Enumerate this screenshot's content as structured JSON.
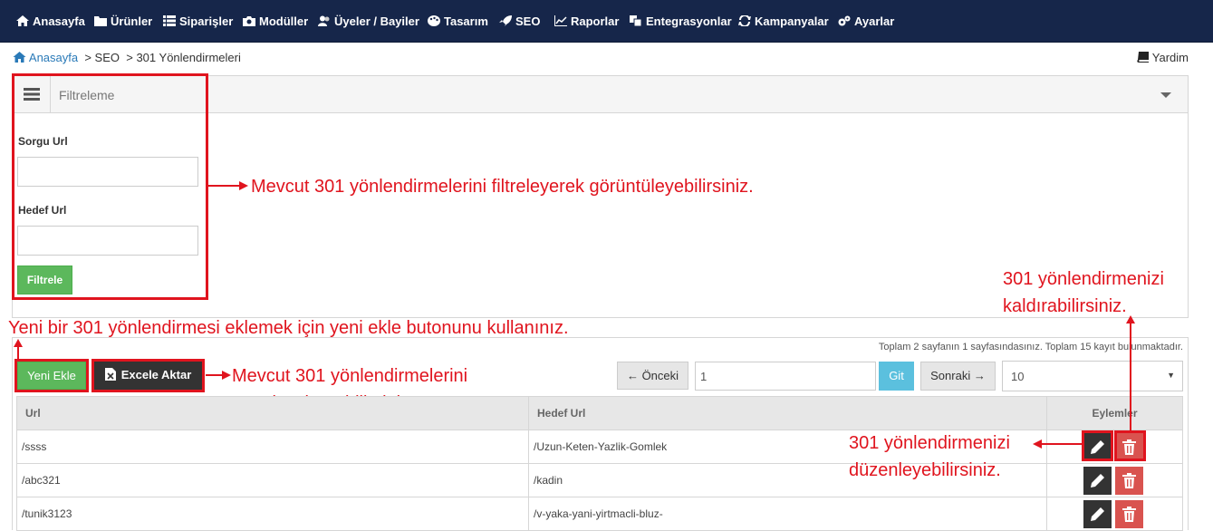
{
  "nav": {
    "items": [
      {
        "label": "Anasayfa",
        "icon": "home-icon"
      },
      {
        "label": "Ürünler",
        "icon": "folder-icon"
      },
      {
        "label": "Siparişler",
        "icon": "list-icon"
      },
      {
        "label": "Modüller",
        "icon": "camera-icon"
      },
      {
        "label": "Üyeler / Bayiler",
        "icon": "users-icon"
      },
      {
        "label": "Tasarım",
        "icon": "palette-icon"
      },
      {
        "label": "SEO",
        "icon": "rocket-icon"
      },
      {
        "label": "Raporlar",
        "icon": "chart-icon"
      },
      {
        "label": "Entegrasyonlar",
        "icon": "plugin-icon"
      },
      {
        "label": "Kampanyalar",
        "icon": "refresh-icon"
      },
      {
        "label": "Ayarlar",
        "icon": "gears-icon"
      }
    ]
  },
  "breadcrumb": {
    "home": "Anasayfa",
    "seo": "> SEO",
    "current": "> 301 Yönlendirmeleri"
  },
  "help": {
    "label": "Yardim"
  },
  "filter": {
    "title": "Filtreleme",
    "source_label": "Sorgu Url",
    "source_value": "",
    "target_label": "Hedef Url",
    "target_value": "",
    "button": "Filtrele"
  },
  "toolbar": {
    "add": "Yeni Ekle",
    "excel": "Excele Aktar",
    "info": "Toplam 2 sayfanın 1 sayfasındasınız. Toplam 15 kayıt bulunmaktadır.",
    "prev": "← Önceki",
    "page": "1",
    "go": "Git",
    "next": "Sonraki →",
    "page_size": "10"
  },
  "table": {
    "headers": {
      "url": "Url",
      "target": "Hedef Url",
      "actions": "Eylemler"
    },
    "rows": [
      {
        "url": "/ssss",
        "target": "/Uzun-Keten-Yazlik-Gomlek"
      },
      {
        "url": "/abc321",
        "target": "/kadin"
      },
      {
        "url": "/tunik3123",
        "target": "/v-yaka-yani-yirtmacli-bluz-"
      }
    ]
  },
  "annotations": {
    "filter": "Mevcut 301 yönlendirmelerini filtreleyerek görüntüleyebilirsiniz.",
    "add": "Yeni bir 301 yönlendirmesi eklemek için yeni ekle butonunu kullanınız.",
    "excel_1": "Mevcut 301 yönlendirmelerini",
    "excel_2": "Excel'e aktarabilirsiniz.",
    "delete_1": "301 yönlendirmenizi",
    "delete_2": "kaldırabilirsiniz.",
    "edit_1": "301 yönlendirmenizi",
    "edit_2": "düzenleyebilirsiniz."
  },
  "colors": {
    "nav_bg": "#16264a",
    "annotation": "#e0141e",
    "primary_green": "#5cb85c",
    "danger": "#d9534f",
    "info_blue": "#5bc0de"
  }
}
